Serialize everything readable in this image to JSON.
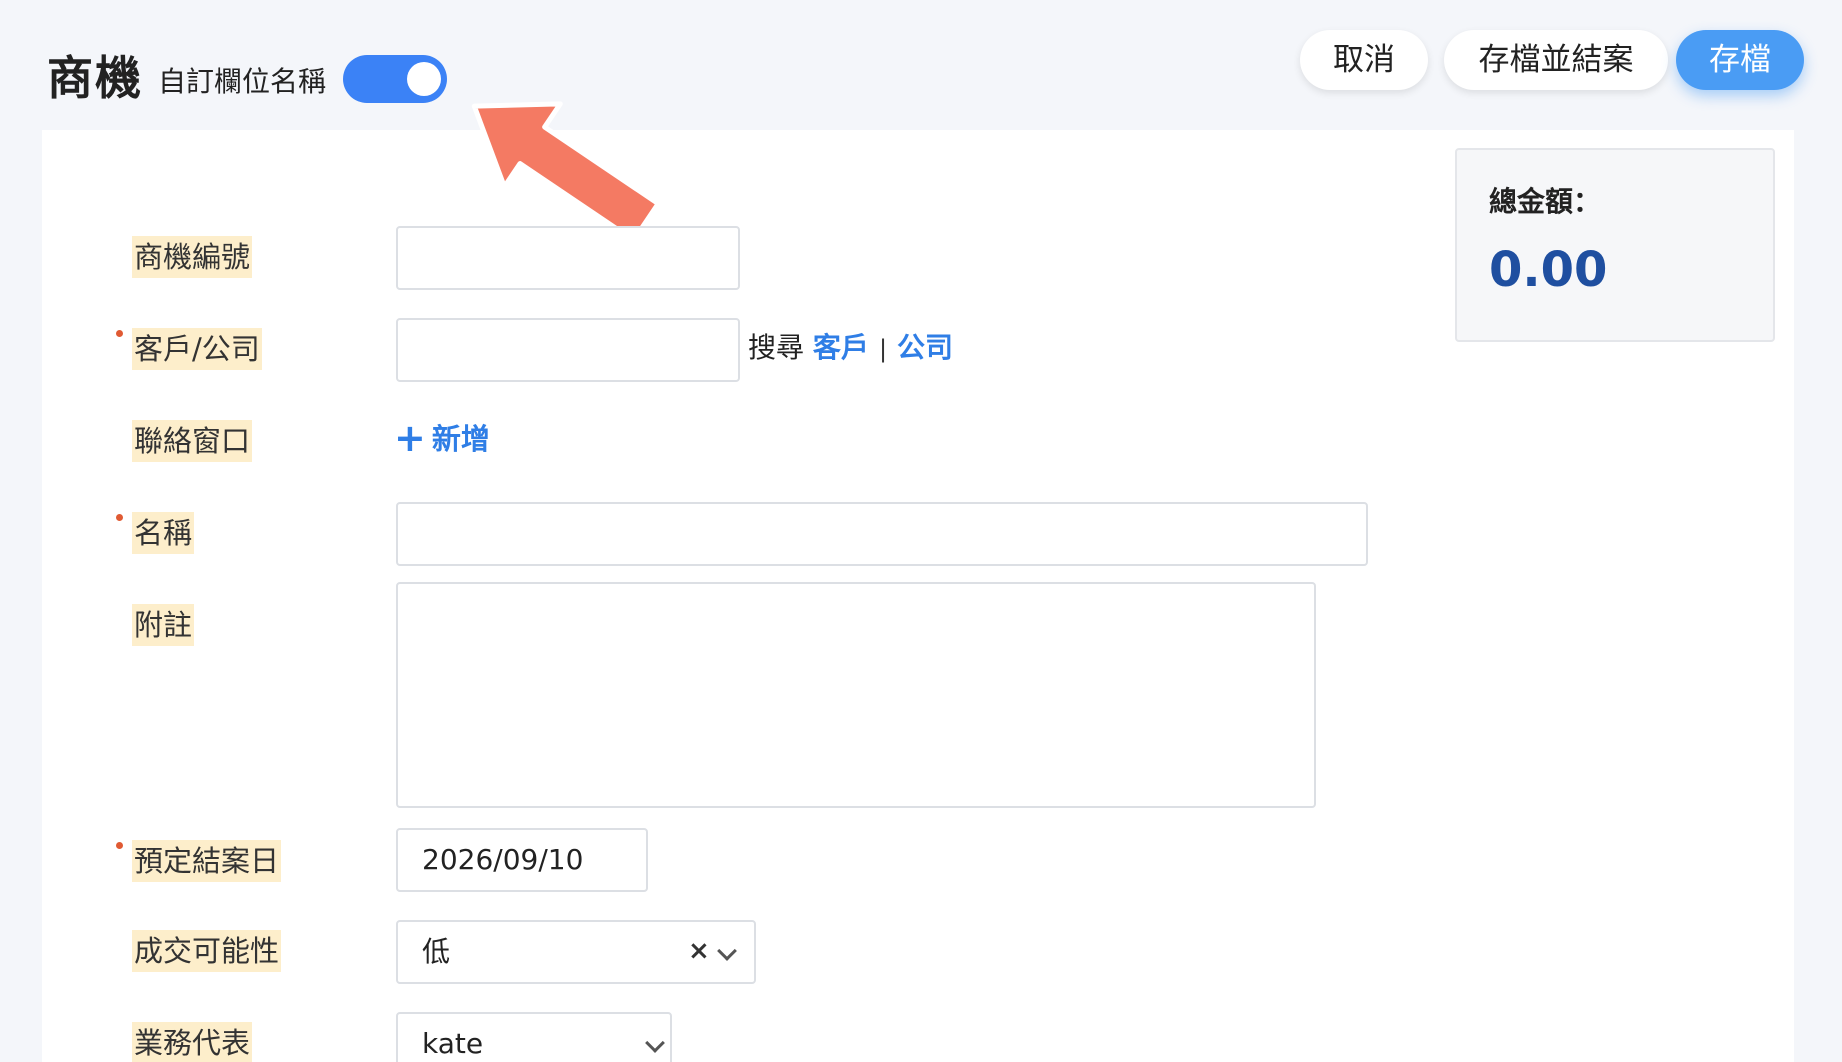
{
  "header": {
    "title": "商機",
    "toggle_label": "自訂欄位名稱",
    "toggle_on": true,
    "buttons": {
      "cancel": "取消",
      "save_and_close": "存檔並結案",
      "save": "存檔"
    }
  },
  "summary": {
    "total_label": "總金額：",
    "total_value": "0.00"
  },
  "form": {
    "opportunity_no": {
      "label": "商機編號",
      "value": ""
    },
    "customer_company": {
      "label": "客戶/公司",
      "value": "",
      "search_prefix": "搜尋",
      "link_customer": "客戶",
      "separator": "|",
      "link_company": "公司"
    },
    "contact": {
      "label": "聯絡窗口",
      "add_label": "新增"
    },
    "name": {
      "label": "名稱",
      "value": ""
    },
    "note": {
      "label": "附註",
      "value": ""
    },
    "close_date": {
      "label": "預定結案日",
      "value": "2026/09/10"
    },
    "probability": {
      "label": "成交可能性",
      "value": "低"
    },
    "sales_rep": {
      "label": "業務代表",
      "value": "kate"
    }
  },
  "colors": {
    "accent": "#3b82f6",
    "link": "#2f7ee6",
    "total": "#1f4fa0",
    "required": "#e05a33",
    "label_highlight": "#fdeecb",
    "annotation_arrow": "#f47a63"
  }
}
